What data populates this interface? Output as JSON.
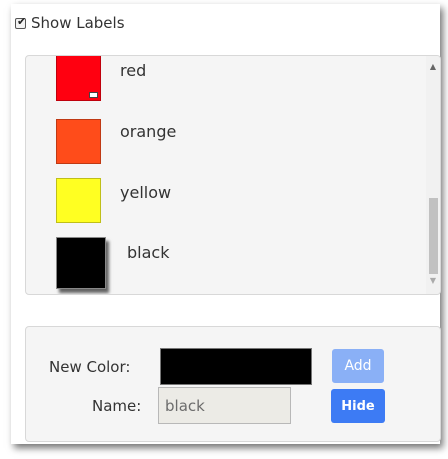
{
  "show_labels": {
    "label": "Show Labels",
    "checked": true
  },
  "colors": [
    {
      "name": "red",
      "hex": "#ff0010",
      "selected": false
    },
    {
      "name": "orange",
      "hex": "#ff4c1a",
      "selected": false
    },
    {
      "name": "yellow",
      "hex": "#ffff22",
      "selected": false
    },
    {
      "name": "black",
      "hex": "#000000",
      "selected": true
    }
  ],
  "form": {
    "new_color_label": "New Color:",
    "new_color_value": "#000000",
    "name_label": "Name:",
    "name_value": "black",
    "add_label": "Add",
    "hide_label": "Hide"
  },
  "theme": {
    "add_button": "#8ab0f6",
    "hide_button": "#3d7bf4",
    "box_bg": "#f5f5f5"
  }
}
